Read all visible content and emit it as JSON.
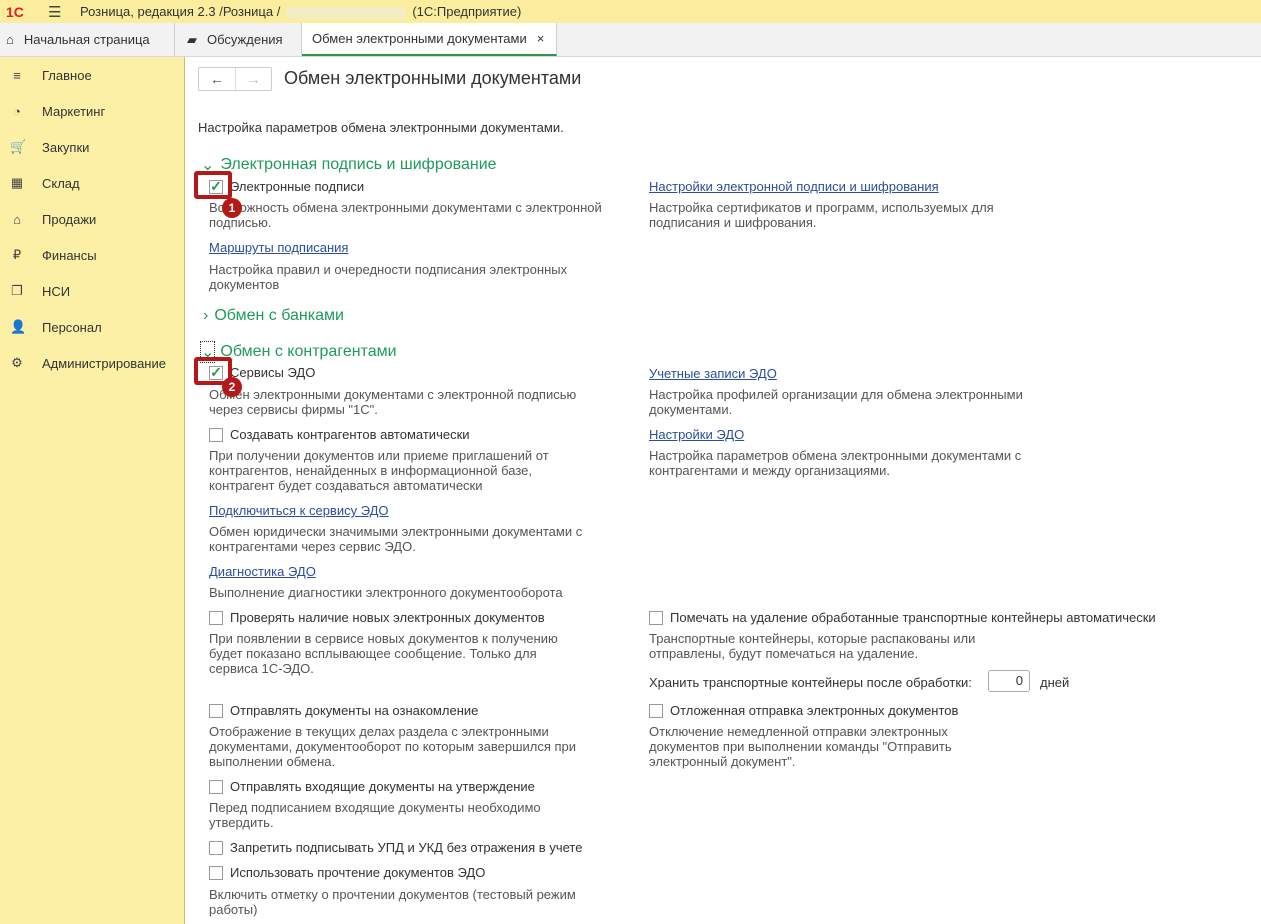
{
  "app": {
    "title_prefix": "Розница, редакция 2.3 /Розница /",
    "title_suffix": "(1С:Предприятие)",
    "logo": "1С"
  },
  "tabs": [
    {
      "label": "Начальная страница",
      "icon": "home-icon"
    },
    {
      "label": "Обсуждения",
      "icon": "chat-icon"
    },
    {
      "label": "Обмен электронными документами",
      "close": "×"
    }
  ],
  "sidebar": {
    "items": [
      {
        "label": "Главное",
        "icon": "≡"
      },
      {
        "label": "Маркетинг",
        "icon": "◔"
      },
      {
        "label": "Закупки",
        "icon": "🛒"
      },
      {
        "label": "Склад",
        "icon": "▦"
      },
      {
        "label": "Продажи",
        "icon": "⌂"
      },
      {
        "label": "Финансы",
        "icon": "₽"
      },
      {
        "label": "НСИ",
        "icon": "❐"
      },
      {
        "label": "Персонал",
        "icon": "👤"
      },
      {
        "label": "Администрирование",
        "icon": "⚙"
      }
    ]
  },
  "page": {
    "title": "Обмен электронными документами",
    "subtitle": "Настройка параметров обмена электронными документами.",
    "back": "←",
    "forward": "→"
  },
  "s1": {
    "title": "Электронная подпись и шифрование",
    "cb_label": "Электронные подписи",
    "cb_desc": "Возможность обмена электронными документами с электронной подписью.",
    "routes_link": "Маршруты подписания",
    "routes_desc": "Настройка правил и очередности подписания электронных документов",
    "settings_link": "Настройки электронной подписи и шифрования",
    "settings_desc": "Настройка сертификатов и программ, используемых для подписания и шифрования.",
    "badge": "1"
  },
  "s2": {
    "title": "Обмен с банками"
  },
  "s3": {
    "title": "Обмен с контрагентами",
    "edo_label": "Сервисы ЭДО",
    "edo_desc": "Обмен электронными документами с электронной подписью через сервисы фирмы \"1С\".",
    "badge": "2",
    "auto_label": "Создавать контрагентов автоматически",
    "auto_desc": "При получении документов или приеме приглашений от контрагентов, ненайденных в информационной базе, контрагент будет создаваться автоматически",
    "connect_link": "Подключиться к сервису ЭДО",
    "connect_desc": "Обмен юридически значимыми электронными документами с контрагентами через сервис ЭДО.",
    "diag_link": "Диагностика ЭДО",
    "diag_desc": "Выполнение диагностики электронного документооборота",
    "check_label": "Проверять наличие новых электронных документов",
    "check_desc": "При появлении в сервисе новых документов к получению будет показано всплывающее сообщение. Только для сервиса 1С-ЭДО.",
    "review_label": "Отправлять документы на ознакомление",
    "review_desc": "Отображение в текущих делах  раздела с электронными документами, документооборот по которым завершился при выполнении обмена.",
    "approve_label": "Отправлять входящие документы на утверждение",
    "approve_desc": "Перед подписанием входящие документы необходимо утвердить.",
    "forbid_label": "Запретить подписывать УПД и УКД без отражения в учете",
    "read_label": "Использовать прочтение документов ЭДО",
    "read_desc": "Включить отметку о прочтении документов (тестовый режим работы)",
    "accounts_link": "Учетные записи ЭДО",
    "accounts_desc": "Настройка профилей организации для обмена электронными документами.",
    "edo_settings_link": "Настройки ЭДО",
    "edo_settings_desc": "Настройка параметров обмена электронными документами с контрагентами и между организациями.",
    "mark_label": "Помечать на удаление обработанные транспортные контейнеры автоматически",
    "mark_desc": "Транспортные контейнеры, которые распакованы или отправлены, будут помечаться на удаление.",
    "keep_label": "Хранить транспортные контейнеры после обработки:",
    "keep_value": "0",
    "keep_unit": "дней",
    "delay_label": "Отложенная отправка электронных документов",
    "delay_desc": "Отключение немедленной отправки электронных документов при выполнении команды \"Отправить электронный документ\"."
  }
}
